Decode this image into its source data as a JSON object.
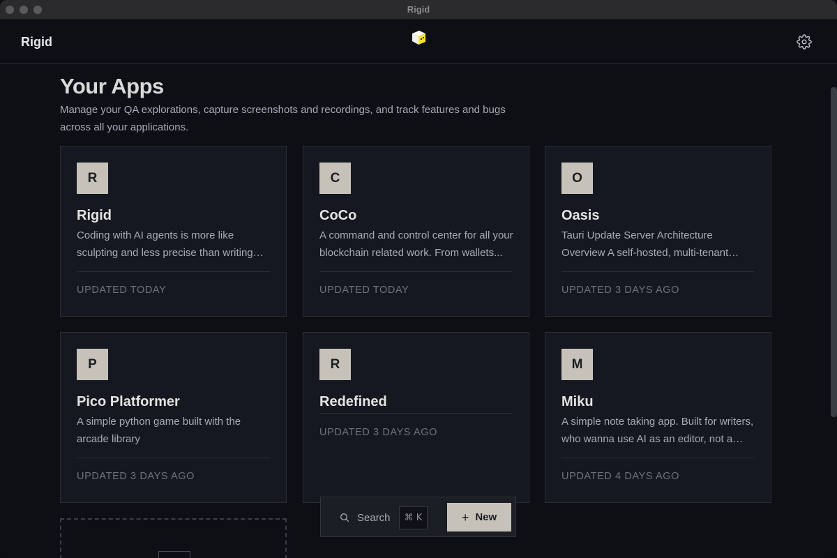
{
  "window": {
    "title": "Rigid"
  },
  "header": {
    "brand": "Rigid"
  },
  "page": {
    "title": "Your Apps",
    "description": "Manage your QA explorations, capture screenshots and recordings, and track features and bugs across all your applications."
  },
  "apps": [
    {
      "initial": "R",
      "name": "Rigid",
      "description": "Coding with AI agents is more like sculpting and less precise than writing code...",
      "updated": "UPDATED TODAY"
    },
    {
      "initial": "C",
      "name": "CoCo",
      "description": "A command and control center for all your blockchain related work. From wallets...",
      "updated": "UPDATED TODAY"
    },
    {
      "initial": "O",
      "name": "Oasis",
      "description": "Tauri Update Server Architecture Overview A self-hosted, multi-tenant update server...",
      "updated": "UPDATED 3 DAYS AGO"
    },
    {
      "initial": "P",
      "name": "Pico Platformer",
      "description": "A simple python game built with the arcade library",
      "updated": "UPDATED 3 DAYS AGO"
    },
    {
      "initial": "R",
      "name": "Redefined",
      "description": "",
      "updated": "UPDATED 3 DAYS AGO"
    },
    {
      "initial": "M",
      "name": "Miku",
      "description": "A simple note taking app. Built for writers, who wanna use AI as an editor, not a writer.",
      "updated": "UPDATED 4 DAYS AGO"
    }
  ],
  "toolbar": {
    "search_label": "Search",
    "shortcut": "⌘ K",
    "new_plus": "+",
    "new_label": "New"
  },
  "colors": {
    "background": "#0d0f15",
    "card": "#151820",
    "accent": "#c6c2ba",
    "logo": "#f5e625"
  },
  "icons": {
    "settings": "gear-icon",
    "search": "search-icon",
    "logo": "cube-logo-icon"
  }
}
